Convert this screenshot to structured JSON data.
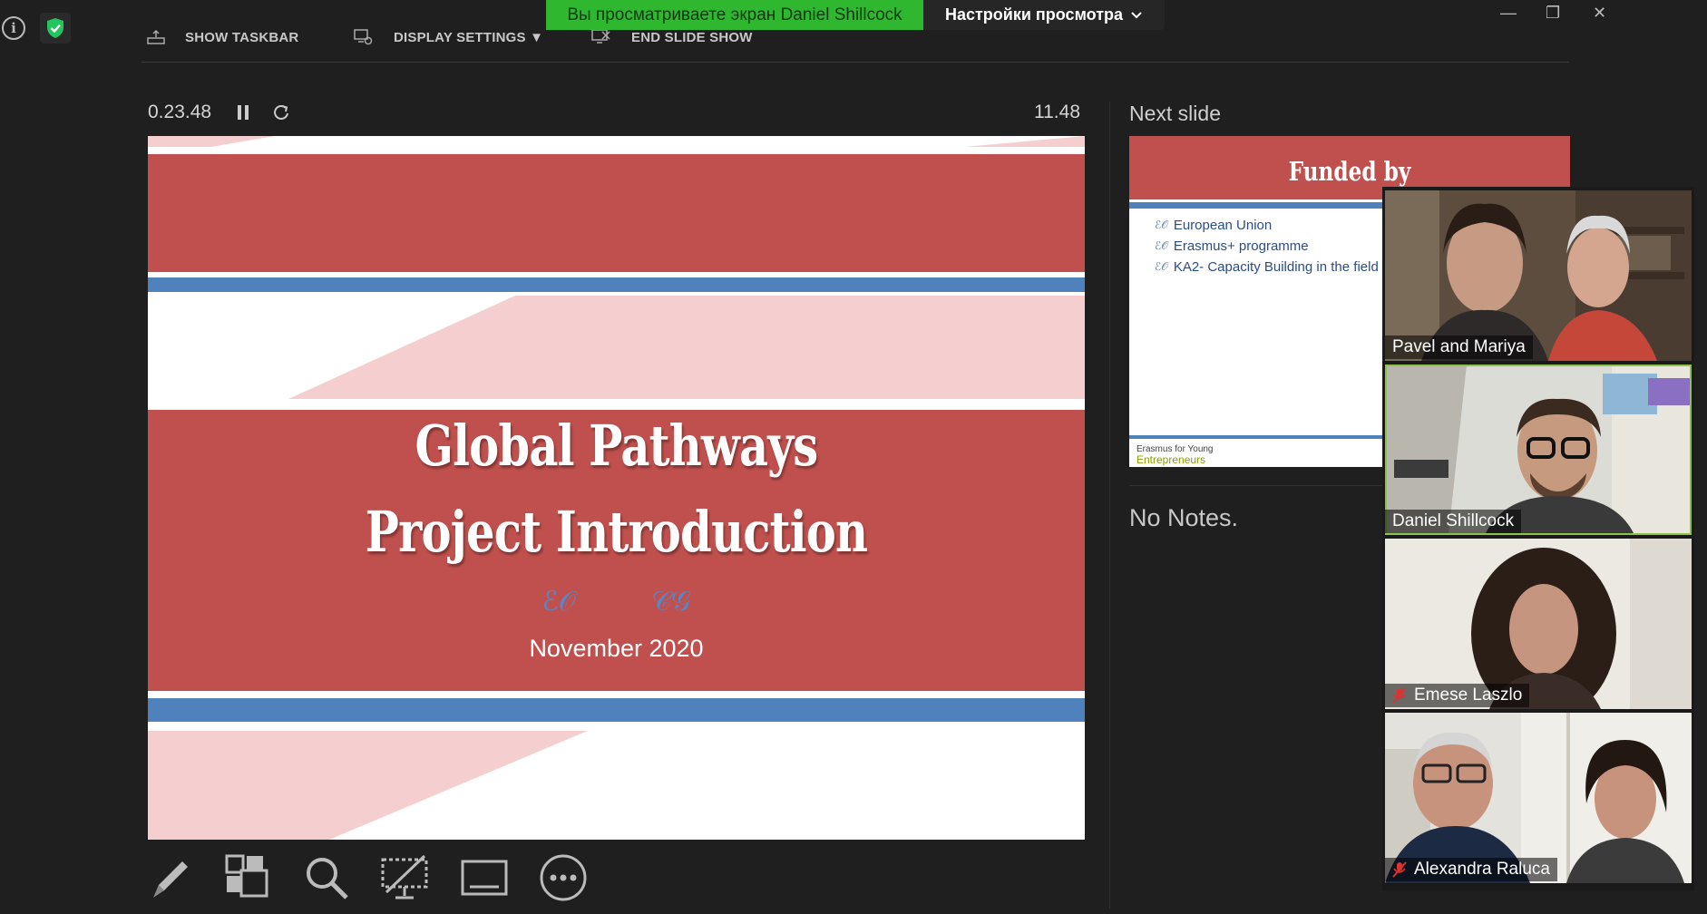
{
  "banner": {
    "text": "Вы просматриваете экран Daniel Shillcock"
  },
  "view_settings": {
    "label": "Настройки просмотра",
    "chevron": "chevron-down-icon"
  },
  "toolbar": {
    "show_taskbar": "SHOW TASKBAR",
    "display_settings": "DISPLAY SETTINGS ▼",
    "end_slide_show": "END SLIDE SHOW"
  },
  "window_controls": {
    "minimize": "—",
    "restore": "❐",
    "close": "✕"
  },
  "presenter": {
    "elapsed": "0.23.48",
    "clock": "11.48",
    "next_slide_label": "Next slide",
    "notes": "No Notes."
  },
  "current_slide": {
    "title_line1": "Global Pathways",
    "title_line2": "Project Introduction",
    "ornament": "ℰ𝒪          𝒞𝒢",
    "date": "November 2020",
    "colors": {
      "red": "#c0504d",
      "blue": "#4f81bd",
      "pink": "#f5cfcf"
    }
  },
  "next_slide": {
    "title": "Funded by",
    "bullets": [
      "European Union",
      "Erasmus+ programme",
      "KA2- Capacity Building in the field"
    ],
    "footer_line1": "Erasmus for Young",
    "footer_line2": "Entrepreneurs"
  },
  "participants": [
    {
      "name": "Pavel and Mariya",
      "muted": false
    },
    {
      "name": "Daniel Shillcock",
      "muted": false,
      "active_speaker": true
    },
    {
      "name": "Emese Laszlo",
      "muted": true
    },
    {
      "name": "Alexandra Raluca",
      "muted": true
    }
  ],
  "bottom_tools": [
    "pen-icon",
    "slides-grid-icon",
    "zoom-icon",
    "black-screen-icon",
    "subtitles-icon",
    "more-icon"
  ]
}
